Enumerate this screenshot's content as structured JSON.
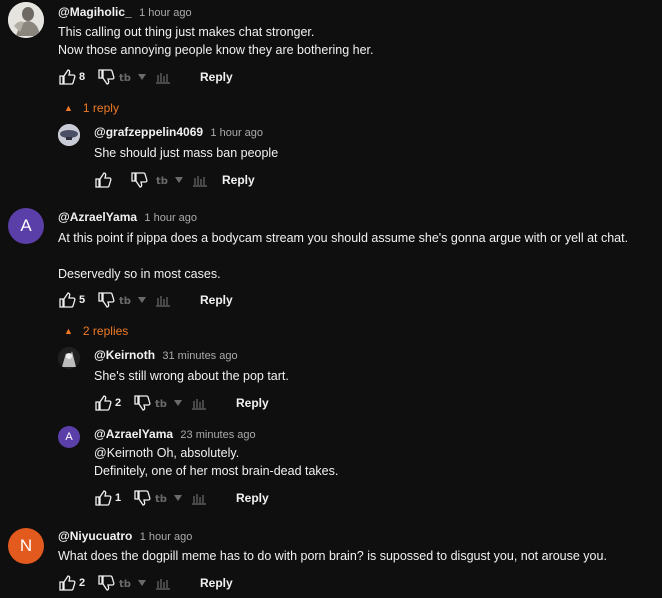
{
  "colors": {
    "background": "#0f0f0f",
    "accent_orange": "#f07a25",
    "avatar_purple": "#5a3fa8",
    "avatar_orange": "#e35a1f"
  },
  "comments": [
    {
      "handle": "@Magiholic_",
      "time": "1 hour ago",
      "text": "This calling out thing just makes chat stronger.\nNow those annoying people know they are bothering her.",
      "likes": "8",
      "reply_label": "Reply",
      "replies_label": "1 reply",
      "replies": [
        {
          "handle": "@grafzeppelin4069",
          "time": "1 hour ago",
          "text": "She should just mass ban people",
          "likes": "",
          "reply_label": "Reply"
        }
      ]
    },
    {
      "handle": "@AzraelYama",
      "time": "1 hour ago",
      "avatar_letter": "A",
      "text": "At this point if pippa does a bodycam stream you should assume she's gonna argue with or yell at chat.\n\nDeservedly so in most cases.",
      "likes": "5",
      "reply_label": "Reply",
      "replies_label": "2 replies",
      "replies": [
        {
          "handle": "@Keirnoth",
          "time": "31 minutes ago",
          "text": "She's still wrong about the pop tart.",
          "likes": "2",
          "reply_label": "Reply"
        },
        {
          "handle": "@AzraelYama",
          "time": "23 minutes ago",
          "avatar_letter": "A",
          "text": "@Keirnoth  Oh, absolutely.\nDefinitely, one of her most brain-dead takes.",
          "likes": "1",
          "reply_label": "Reply"
        }
      ]
    },
    {
      "handle": "@Niyucuatro",
      "time": "1 hour ago",
      "avatar_letter": "N",
      "text": "What does the dogpill meme has to do with porn brain? is supossed to disgust you, not arouse you.",
      "likes": "2",
      "reply_label": "Reply"
    }
  ]
}
